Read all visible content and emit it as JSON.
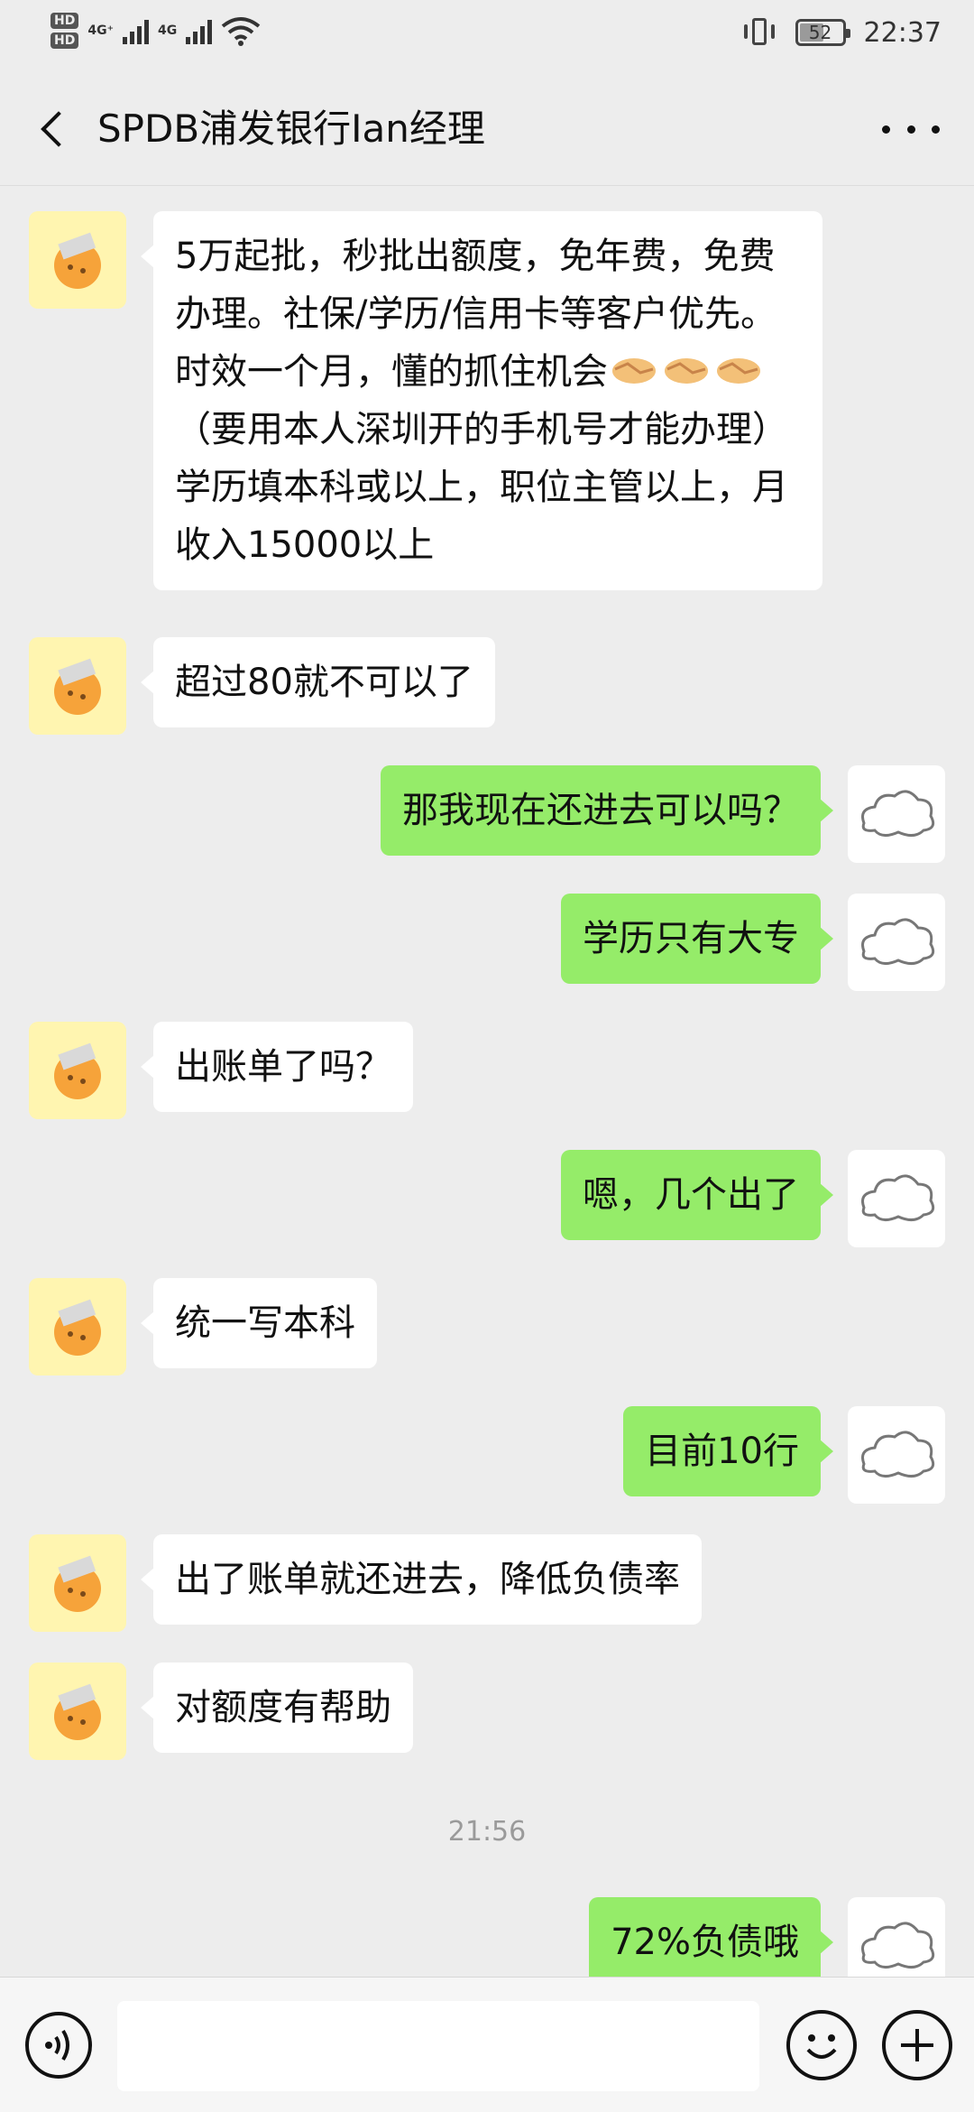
{
  "status_bar": {
    "hd1": "HD",
    "hd2": "HD",
    "net1": "4G⁺",
    "net2": "4G",
    "battery": "52",
    "time": "22:37"
  },
  "header": {
    "title": "SPDB浦发银行Ian经理",
    "back_icon": "chevron-left-icon",
    "more_icon": "more-dots-icon"
  },
  "messages": [
    {
      "side": "left",
      "text": "5万起批，秒批出额度，免年费，免费办理。社保/学历/信用卡等客户优先。时效一个月，懂的抓住机会",
      "emoji": "handshake-emoji x3",
      "text2": "（要用本人深圳开的手机号才能办理）学历填本科或以上，职位主管以上，月收入15000以上"
    },
    {
      "side": "left",
      "text": "超过80就不可以了"
    },
    {
      "side": "right",
      "text": "那我现在还进去可以吗？"
    },
    {
      "side": "right",
      "text": "学历只有大专"
    },
    {
      "side": "left",
      "text": "出账单了吗？"
    },
    {
      "side": "right",
      "text": "嗯，几个出了"
    },
    {
      "side": "left",
      "text": "统一写本科"
    },
    {
      "side": "right",
      "text": "目前10行"
    },
    {
      "side": "left",
      "text": "出了账单就还进去，降低负债率"
    },
    {
      "side": "left",
      "text": "对额度有帮助"
    },
    {
      "side": "right",
      "text": "72%负债哦"
    }
  ],
  "time_divider": "21:56",
  "input_bar": {
    "voice_icon": "voice-icon",
    "emoji_icon": "smiley-icon",
    "plus_icon": "plus-circle-icon",
    "input_value": ""
  }
}
